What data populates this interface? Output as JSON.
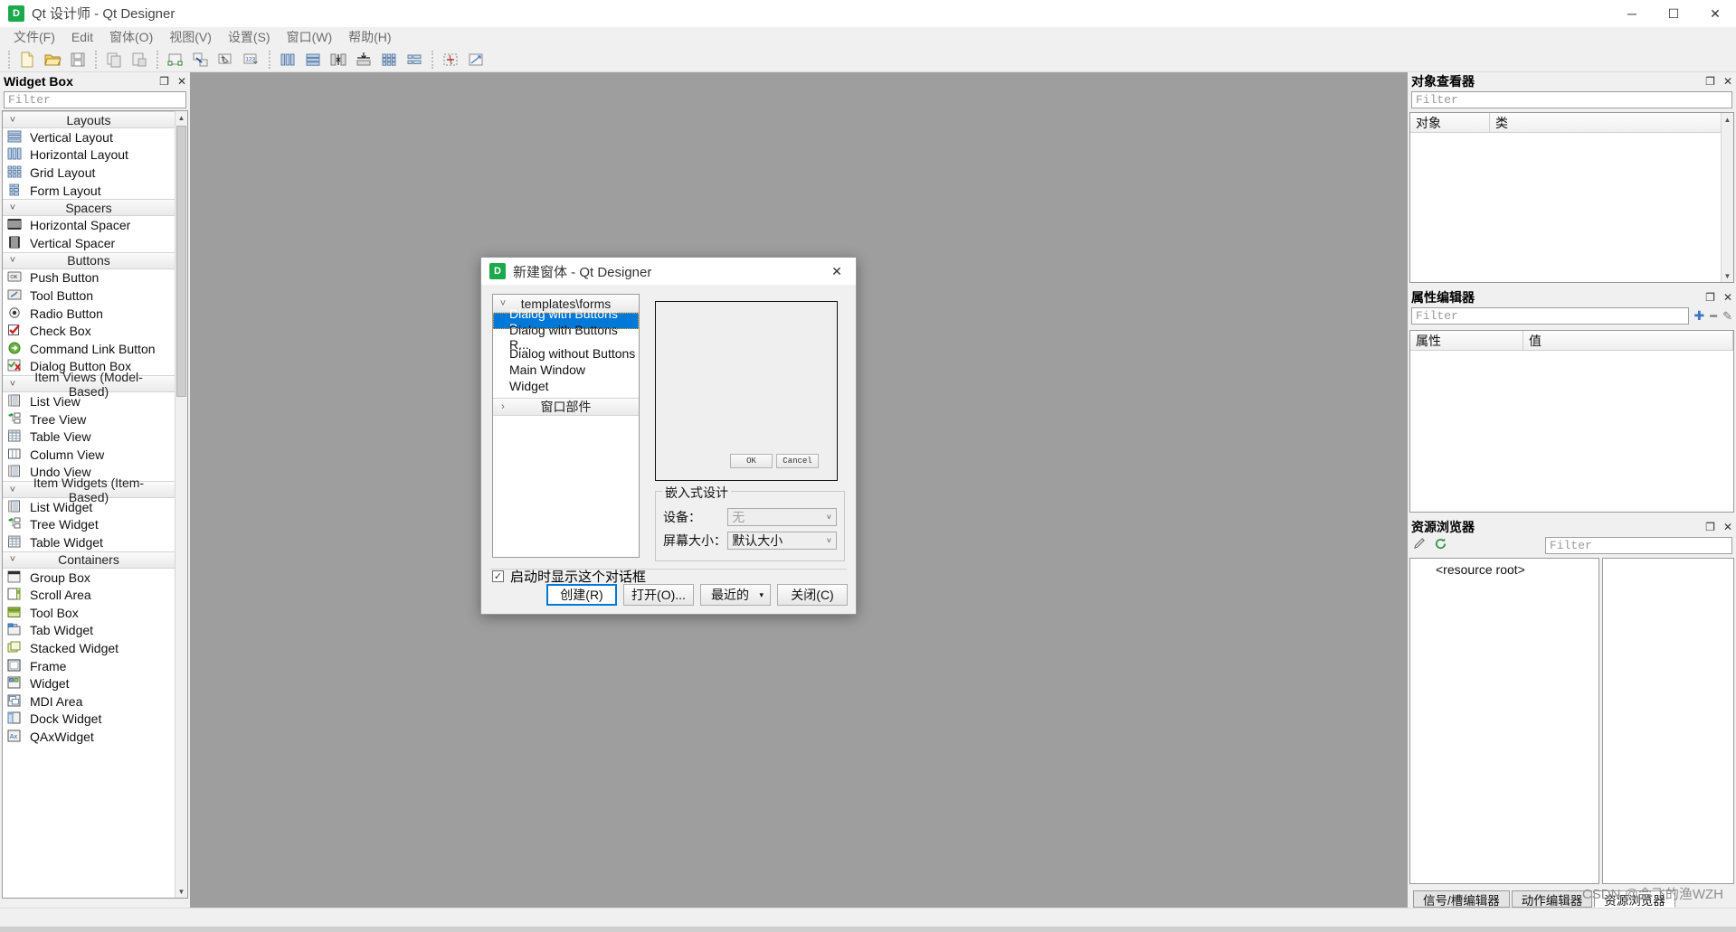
{
  "window": {
    "title": "Qt 设计师 - Qt Designer",
    "app_icon_letter": "D",
    "minimize": "─",
    "maximize": "☐",
    "close": "✕"
  },
  "menubar": {
    "items": [
      {
        "label": "文件(F)",
        "name": "menu-file"
      },
      {
        "label": "Edit",
        "name": "menu-edit"
      },
      {
        "label": "窗体(O)",
        "name": "menu-form"
      },
      {
        "label": "视图(V)",
        "name": "menu-view"
      },
      {
        "label": "设置(S)",
        "name": "menu-settings"
      },
      {
        "label": "窗口(W)",
        "name": "menu-window"
      },
      {
        "label": "帮助(H)",
        "name": "menu-help"
      }
    ]
  },
  "toolbar": {
    "buttons": [
      "new-file-icon",
      "open-file-icon",
      "save-file-icon",
      "copy-icon",
      "paste-icon",
      "edit-widgets-icon",
      "edit-signals-slots-icon",
      "edit-buddies-icon",
      "edit-tab-order-icon",
      "layout-horizontally-icon",
      "layout-vertically-icon",
      "layout-splitter-horizontal-icon",
      "layout-splitter-vertical-icon",
      "layout-grid-icon",
      "layout-form-icon",
      "break-layout-icon",
      "adjust-size-icon"
    ]
  },
  "widget_box": {
    "title": "Widget Box",
    "float_icon": "❐",
    "close_icon": "✕",
    "filter_placeholder": "Filter",
    "filter_value": "",
    "categories": [
      {
        "name": "Layouts",
        "expanded": true,
        "items": [
          {
            "label": "Vertical Layout",
            "icon": "vertical-layout-icon"
          },
          {
            "label": "Horizontal Layout",
            "icon": "horizontal-layout-icon"
          },
          {
            "label": "Grid Layout",
            "icon": "grid-layout-icon"
          },
          {
            "label": "Form Layout",
            "icon": "form-layout-icon"
          }
        ]
      },
      {
        "name": "Spacers",
        "expanded": true,
        "items": [
          {
            "label": "Horizontal Spacer",
            "icon": "horizontal-spacer-icon"
          },
          {
            "label": "Vertical Spacer",
            "icon": "vertical-spacer-icon"
          }
        ]
      },
      {
        "name": "Buttons",
        "expanded": true,
        "items": [
          {
            "label": "Push Button",
            "icon": "push-button-icon"
          },
          {
            "label": "Tool Button",
            "icon": "tool-button-icon"
          },
          {
            "label": "Radio Button",
            "icon": "radio-button-icon"
          },
          {
            "label": "Check Box",
            "icon": "check-box-icon"
          },
          {
            "label": "Command Link Button",
            "icon": "command-link-button-icon"
          },
          {
            "label": "Dialog Button Box",
            "icon": "dialog-button-box-icon"
          }
        ]
      },
      {
        "name": "Item Views (Model-Based)",
        "expanded": true,
        "items": [
          {
            "label": "List View",
            "icon": "list-view-icon"
          },
          {
            "label": "Tree View",
            "icon": "tree-view-icon"
          },
          {
            "label": "Table View",
            "icon": "table-view-icon"
          },
          {
            "label": "Column View",
            "icon": "column-view-icon"
          },
          {
            "label": "Undo View",
            "icon": "undo-view-icon"
          }
        ]
      },
      {
        "name": "Item Widgets (Item-Based)",
        "expanded": true,
        "items": [
          {
            "label": "List Widget",
            "icon": "list-widget-icon"
          },
          {
            "label": "Tree Widget",
            "icon": "tree-widget-icon"
          },
          {
            "label": "Table Widget",
            "icon": "table-widget-icon"
          }
        ]
      },
      {
        "name": "Containers",
        "expanded": true,
        "items": [
          {
            "label": "Group Box",
            "icon": "group-box-icon"
          },
          {
            "label": "Scroll Area",
            "icon": "scroll-area-icon"
          },
          {
            "label": "Tool Box",
            "icon": "tool-box-icon"
          },
          {
            "label": "Tab Widget",
            "icon": "tab-widget-icon"
          },
          {
            "label": "Stacked Widget",
            "icon": "stacked-widget-icon"
          },
          {
            "label": "Frame",
            "icon": "frame-icon"
          },
          {
            "label": "Widget",
            "icon": "widget-icon"
          },
          {
            "label": "MDI Area",
            "icon": "mdi-area-icon"
          },
          {
            "label": "Dock Widget",
            "icon": "dock-widget-icon"
          },
          {
            "label": "QAxWidget",
            "icon": "qaxwidget-icon"
          }
        ]
      }
    ]
  },
  "object_inspector": {
    "title": "对象查看器",
    "float_icon": "❐",
    "close_icon": "✕",
    "filter_placeholder": "Filter",
    "columns": [
      "对象",
      "类"
    ],
    "rows": []
  },
  "property_editor": {
    "title": "属性编辑器",
    "float_icon": "❐",
    "close_icon": "✕",
    "filter_placeholder": "Filter",
    "add_icon": "✚",
    "remove_icon": "━",
    "configure_icon": "✎",
    "columns": [
      "属性",
      "值"
    ],
    "rows": []
  },
  "resource_browser": {
    "title": "资源浏览器",
    "float_icon": "❐",
    "close_icon": "✕",
    "edit_icon": "pencil-icon",
    "reload_icon": "reload-icon",
    "filter_placeholder": "Filter",
    "root_label": "<resource root>"
  },
  "bottom_tabs": [
    {
      "label": "信号/槽编辑器",
      "active": false
    },
    {
      "label": "动作编辑器",
      "active": false
    },
    {
      "label": "资源浏览器",
      "active": true
    }
  ],
  "dialog": {
    "icon_letter": "D",
    "title": "新建窗体 - Qt Designer",
    "close_icon": "✕",
    "template_group": {
      "label": "templates\\forms",
      "chevron": "˅",
      "expanded": true
    },
    "templates": [
      {
        "label": "Dialog with Buttons B...",
        "selected": true
      },
      {
        "label": "Dialog with Buttons R...",
        "selected": false
      },
      {
        "label": "Dialog without Buttons",
        "selected": false
      },
      {
        "label": "Main Window",
        "selected": false
      },
      {
        "label": "Widget",
        "selected": false
      }
    ],
    "second_group": {
      "label": "窗口部件",
      "chevron": "›",
      "expanded": false
    },
    "preview": {
      "ok_label": "OK",
      "cancel_label": "Cancel"
    },
    "embedded": {
      "legend": "嵌入式设计",
      "device_label": "设备：",
      "device_value": "无",
      "device_disabled": true,
      "screen_size_label": "屏幕大小：",
      "screen_size_value": "默认大小",
      "dropdown_arrow": "˅"
    },
    "show_on_startup": {
      "label": "启动时显示这个对话框",
      "checked": true,
      "check_glyph": "✓"
    },
    "buttons": [
      {
        "label": "创建(R)",
        "style": "default"
      },
      {
        "label": "打开(O)...",
        "style": "normal"
      },
      {
        "label": "最近的",
        "style": "split",
        "arrow": "▾"
      },
      {
        "label": "关闭(C)",
        "style": "normal"
      }
    ]
  },
  "watermark": "CSDN @会飞的渔WZH",
  "colors": {
    "accent": "#0078d7",
    "canvas": "#9e9e9e",
    "chrome": "#f0f0f0",
    "app_green": "#1ba94c"
  }
}
